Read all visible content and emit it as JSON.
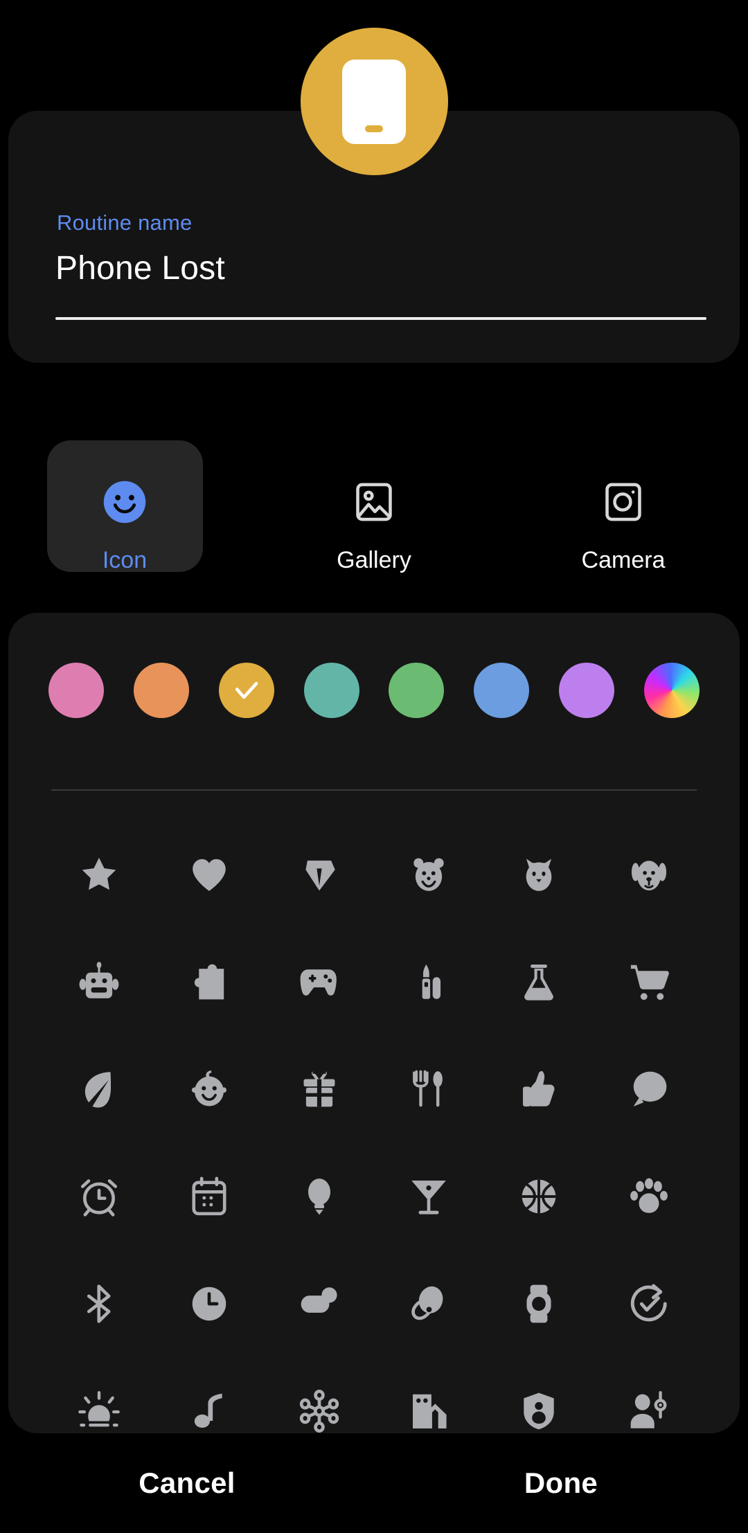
{
  "avatar": {
    "icon": "phone-icon",
    "background_color": "#E0AE3E",
    "foreground_color": "#FFFFFF"
  },
  "name_card": {
    "label": "Routine name",
    "value": "Phone Lost",
    "placeholder": "Routine name",
    "label_color": "#5E8BEF"
  },
  "tabs": [
    {
      "id": "icon",
      "label": "Icon",
      "icon": "smiley-face-icon",
      "selected": true
    },
    {
      "id": "gallery",
      "label": "Gallery",
      "icon": "image-icon",
      "selected": false
    },
    {
      "id": "camera",
      "label": "Camera",
      "icon": "camera-icon",
      "selected": false
    }
  ],
  "colors": [
    {
      "name": "pink",
      "hex": "#DE7EB0",
      "selected": false
    },
    {
      "name": "orange",
      "hex": "#E8935A",
      "selected": false
    },
    {
      "name": "amber",
      "hex": "#E0AE3E",
      "selected": true
    },
    {
      "name": "teal",
      "hex": "#63B5A8",
      "selected": false
    },
    {
      "name": "green",
      "hex": "#6CBB72",
      "selected": false
    },
    {
      "name": "blue",
      "hex": "#6C9DE0",
      "selected": false
    },
    {
      "name": "purple",
      "hex": "#BE7FEE",
      "selected": false
    },
    {
      "name": "rainbow",
      "hex": "gradient",
      "selected": false
    }
  ],
  "icon_grid": {
    "glyph_color": "#ADAEB2",
    "columns": 6,
    "icons": [
      "star-icon",
      "heart-icon",
      "gem-icon",
      "bear-icon",
      "cat-icon",
      "dog-icon",
      "robot-icon",
      "puzzle-piece-icon",
      "gamepad-icon",
      "lipstick-icon",
      "flask-icon",
      "shopping-cart-icon",
      "leaf-icon",
      "baby-face-icon",
      "gift-icon",
      "restaurant-icon",
      "thumbs-up-icon",
      "chat-bubble-icon",
      "alarm-clock-icon",
      "calendar-icon",
      "lightbulb-icon",
      "cocktail-icon",
      "basketball-icon",
      "paw-print-icon",
      "bluetooth-icon",
      "clock-icon",
      "toggle-switch-icon",
      "earbud-icon",
      "smartwatch-icon",
      "refresh-check-icon",
      "sunrise-icon",
      "music-note-icon",
      "hub-icon",
      "home-icon",
      "shield-icon",
      "person-antenna-icon"
    ]
  },
  "bottom_bar": {
    "cancel_label": "Cancel",
    "done_label": "Done"
  }
}
